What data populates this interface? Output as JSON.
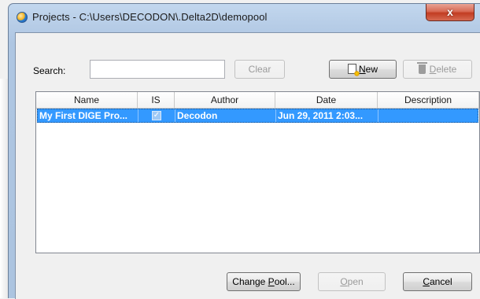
{
  "window": {
    "title": "Projects - C:\\Users\\DECODON\\.Delta2D\\demopool",
    "close_glyph": "x"
  },
  "search": {
    "label": "Search:",
    "value": "",
    "placeholder": ""
  },
  "toolbar": {
    "clear_label": "Clear",
    "new_mnemonic": "N",
    "new_rest": "ew",
    "delete_mnemonic": "D",
    "delete_rest": "elete"
  },
  "table": {
    "columns": [
      "Name",
      "IS",
      "Author",
      "Date",
      "Description"
    ],
    "rows": [
      {
        "name": "My First DIGE Pro...",
        "is_checked": true,
        "author": "Decodon",
        "date": "Jun 29, 2011 2:03...",
        "description": "",
        "selected": true
      }
    ]
  },
  "footer": {
    "change_pool_pre": "Change ",
    "change_pool_mnemonic": "P",
    "change_pool_rest": "ool...",
    "open_mnemonic": "O",
    "open_rest": "pen",
    "cancel_mnemonic": "C",
    "cancel_rest": "ancel"
  },
  "colors": {
    "selection": "#3399ff",
    "frame": "#b7cde7",
    "close_button": "#c23c22"
  },
  "icons": {
    "app": "app-orb-icon",
    "new": "new-document-icon",
    "delete": "trash-icon",
    "close": "close-icon"
  }
}
